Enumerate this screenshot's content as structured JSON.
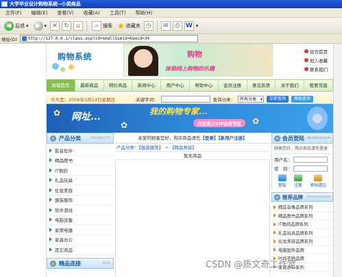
{
  "window": {
    "title": "大学毕业设计购物系统--小类商品"
  },
  "menu": [
    "文件(F)",
    "编辑(E)",
    "查看(V)",
    "收藏(A)",
    "工具(T)",
    "帮助(H)"
  ],
  "toolbar": {
    "back": "后退",
    "search": "搜索",
    "favorites": "收藏夹"
  },
  "address": {
    "label": "地址(D)",
    "url": "http://127.0.0.1/class.asp?id=small&smid=6&mid=34"
  },
  "header": {
    "logo": "购物系统",
    "banner_slogan1": "购物",
    "banner_slogan2": "体验网上购物的乐趣",
    "quicklinks": [
      "设为首页",
      "加入收藏",
      "联系我们"
    ]
  },
  "nav": [
    "商城首页",
    "最新商品",
    "特价商品",
    "新闻中心",
    "用户中心",
    "帮助中心",
    "会员注册",
    "意见反馈",
    "关于我们",
    "我要充值"
  ],
  "infobar": {
    "date": "今天是：2006年5月14日星期日",
    "keyword_label": "关键字词：",
    "category_label": "查询分类：",
    "category_value": "所有分类",
    "search_button": "立即查询",
    "advanced_button": "高级查询"
  },
  "promo": {
    "text1": "网址...",
    "text2": "我的购物专家...",
    "text3": "点击进入VIP会员专区"
  },
  "left": {
    "products_title": "产品分类",
    "products_en": "PRODUCTS",
    "categories": [
      "影音软件",
      "精品图书",
      "IT数码",
      "礼品玩具",
      "化妆美容",
      "服装服饰",
      "软件游戏",
      "电脑设备",
      "家用电器",
      "家具办公",
      "其它商品"
    ],
    "links_title": "精品连接",
    "links_en": "ROS"
  },
  "main": {
    "welcome_prefix": "亲爱的顾客您好，购买商品请先",
    "login": "【登录】",
    "register": "【新用户注册】",
    "category_path": "产品分类：【服装服饰】 → 【精品男装】",
    "empty": "暂无商品"
  },
  "right": {
    "member_title": "会员登陆",
    "member_en": "MEMBERLOGIN",
    "member_msg": "顾客您好，购买商品请先登录",
    "username_label": "用户名：",
    "password_label": "密　码：",
    "btn_login": "登陆",
    "btn_register": "注册",
    "btn_forgot": "密码遗忘",
    "brand_title": "推荐品牌",
    "brand_en": "Recommended",
    "brands": [
      "精品音像品牌系列",
      "精品图书品牌系列",
      "IT数码品牌系列",
      "礼品玩具品牌系列",
      "化妆美容品牌系列",
      "电脑配件品牌",
      "时尚衣物品牌",
      "家具办公系列"
    ]
  },
  "watermark": "CSDN @质文奇工作室"
}
